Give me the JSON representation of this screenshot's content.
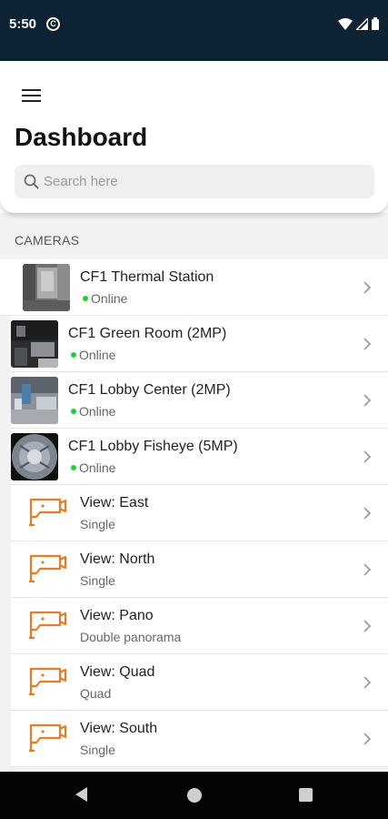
{
  "status_bar": {
    "time": "5:50"
  },
  "header": {
    "title": "Dashboard",
    "search_placeholder": "Search here"
  },
  "section": {
    "title": "CAMERAS"
  },
  "cameras": [
    {
      "name": "CF1  Thermal Station",
      "status": "Online"
    },
    {
      "name": "CF1 Green Room (2MP)",
      "status": "Online"
    },
    {
      "name": "CF1 Lobby Center (2MP)",
      "status": "Online"
    },
    {
      "name": "CF1 Lobby Fisheye (5MP)",
      "status": "Online"
    }
  ],
  "views": [
    {
      "name": "View: East",
      "layout": "Single"
    },
    {
      "name": "View: North",
      "layout": "Single"
    },
    {
      "name": "View: Pano",
      "layout": "Double panorama"
    },
    {
      "name": "View: Quad",
      "layout": "Quad"
    },
    {
      "name": "View: South",
      "layout": "Single"
    }
  ],
  "colors": {
    "status_bar": "#0d2333",
    "online": "#1fd12e",
    "view_icon": "#f07a22",
    "list_background": "#f2f2f4"
  }
}
